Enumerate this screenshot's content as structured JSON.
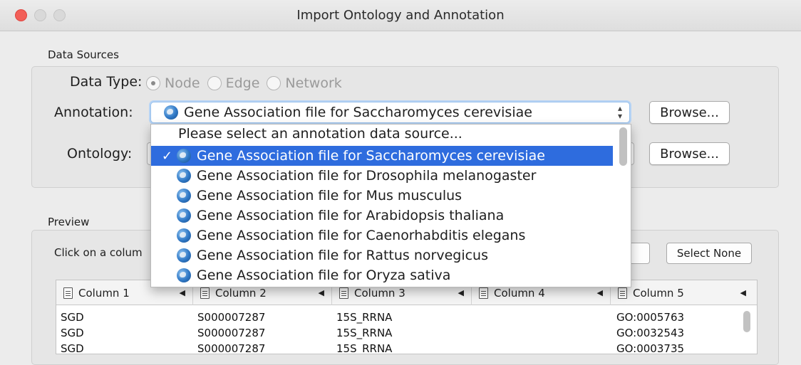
{
  "window": {
    "title": "Import Ontology and Annotation"
  },
  "data_sources": {
    "group_label": "Data Sources",
    "data_type_label": "Data Type:",
    "data_type_options": [
      "Node",
      "Edge",
      "Network"
    ],
    "data_type_selected": "Node",
    "annotation_label": "Annotation:",
    "annotation_value": "Gene Association file for Saccharomyces cerevisiae",
    "annotation_browse": "Browse...",
    "ontology_label": "Ontology:",
    "ontology_browse": "Browse..."
  },
  "dropdown": {
    "placeholder": "Please select an annotation data source...",
    "check_mark": "✓",
    "options": [
      "Gene Association file for Saccharomyces cerevisiae",
      "Gene Association file for Drosophila melanogaster",
      "Gene Association file for Mus musculus",
      "Gene Association file for Arabidopsis thaliana",
      "Gene Association file for Caenorhabditis elegans",
      "Gene Association file for Rattus norvegicus",
      "Gene Association file for Oryza sativa"
    ],
    "selected_index": 0
  },
  "preview": {
    "group_label": "Preview",
    "hint": "Click on a colum",
    "select_none": "Select None",
    "columns": [
      "Column 1",
      "Column 2",
      "Column 3",
      "Column 4",
      "Column 5"
    ],
    "rows": [
      [
        "SGD",
        "S000007287",
        "15S_RRNA",
        "",
        "GO:0005763"
      ],
      [
        "SGD",
        "S000007287",
        "15S_RRNA",
        "",
        "GO:0032543"
      ],
      [
        "SGD",
        "S000007287",
        "15S_RRNA",
        "",
        "GO:0003735"
      ]
    ]
  },
  "icons": {
    "globe": "globe-icon",
    "document": "document-icon",
    "sort": "sort-arrow-icon"
  }
}
